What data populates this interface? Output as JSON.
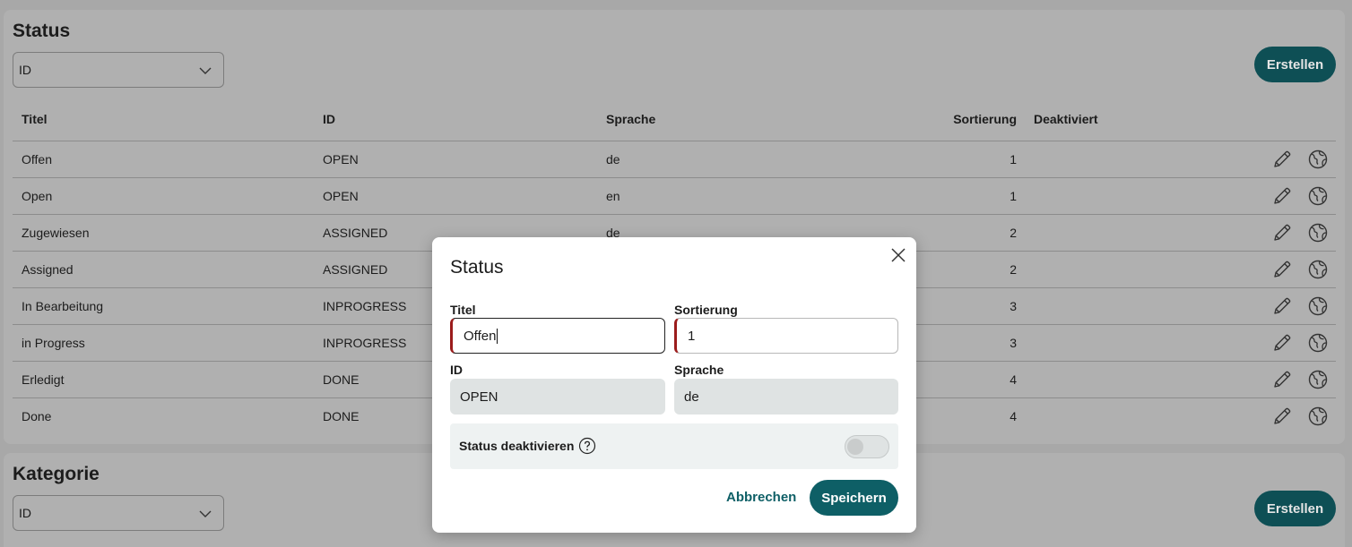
{
  "status_section": {
    "title": "Status",
    "filter_value": "ID",
    "create_label": "Erstellen",
    "columns": {
      "titel": "Titel",
      "id": "ID",
      "sprache": "Sprache",
      "sortierung": "Sortierung",
      "deaktiviert": "Deaktiviert"
    },
    "rows": [
      {
        "titel": "Offen",
        "id": "OPEN",
        "sprache": "de",
        "sortierung": "1"
      },
      {
        "titel": "Open",
        "id": "OPEN",
        "sprache": "en",
        "sortierung": "1"
      },
      {
        "titel": "Zugewiesen",
        "id": "ASSIGNED",
        "sprache": "de",
        "sortierung": "2"
      },
      {
        "titel": "Assigned",
        "id": "ASSIGNED",
        "sprache": "",
        "sortierung": "2"
      },
      {
        "titel": "In Bearbeitung",
        "id": "INPROGRESS",
        "sprache": "",
        "sortierung": "3"
      },
      {
        "titel": "in Progress",
        "id": "INPROGRESS",
        "sprache": "",
        "sortierung": "3"
      },
      {
        "titel": "Erledigt",
        "id": "DONE",
        "sprache": "",
        "sortierung": "4"
      },
      {
        "titel": "Done",
        "id": "DONE",
        "sprache": "",
        "sortierung": "4"
      }
    ]
  },
  "kategorie_section": {
    "title": "Kategorie",
    "filter_value": "ID",
    "create_label": "Erstellen"
  },
  "dialog": {
    "title": "Status",
    "titel_label": "Titel",
    "titel_value": "Offen",
    "sortierung_label": "Sortierung",
    "sortierung_value": "1",
    "id_label": "ID",
    "id_value": "OPEN",
    "sprache_label": "Sprache",
    "sprache_value": "de",
    "deactivate_label": "Status deaktivieren",
    "deactivate_on": false,
    "cancel_label": "Abbrechen",
    "save_label": "Speichern"
  },
  "colors": {
    "primary": "#0e5f66",
    "required": "#9b1c1c"
  },
  "icons": [
    "chevron-down-icon",
    "pencil-icon",
    "globe-icon",
    "close-icon",
    "help-icon"
  ]
}
